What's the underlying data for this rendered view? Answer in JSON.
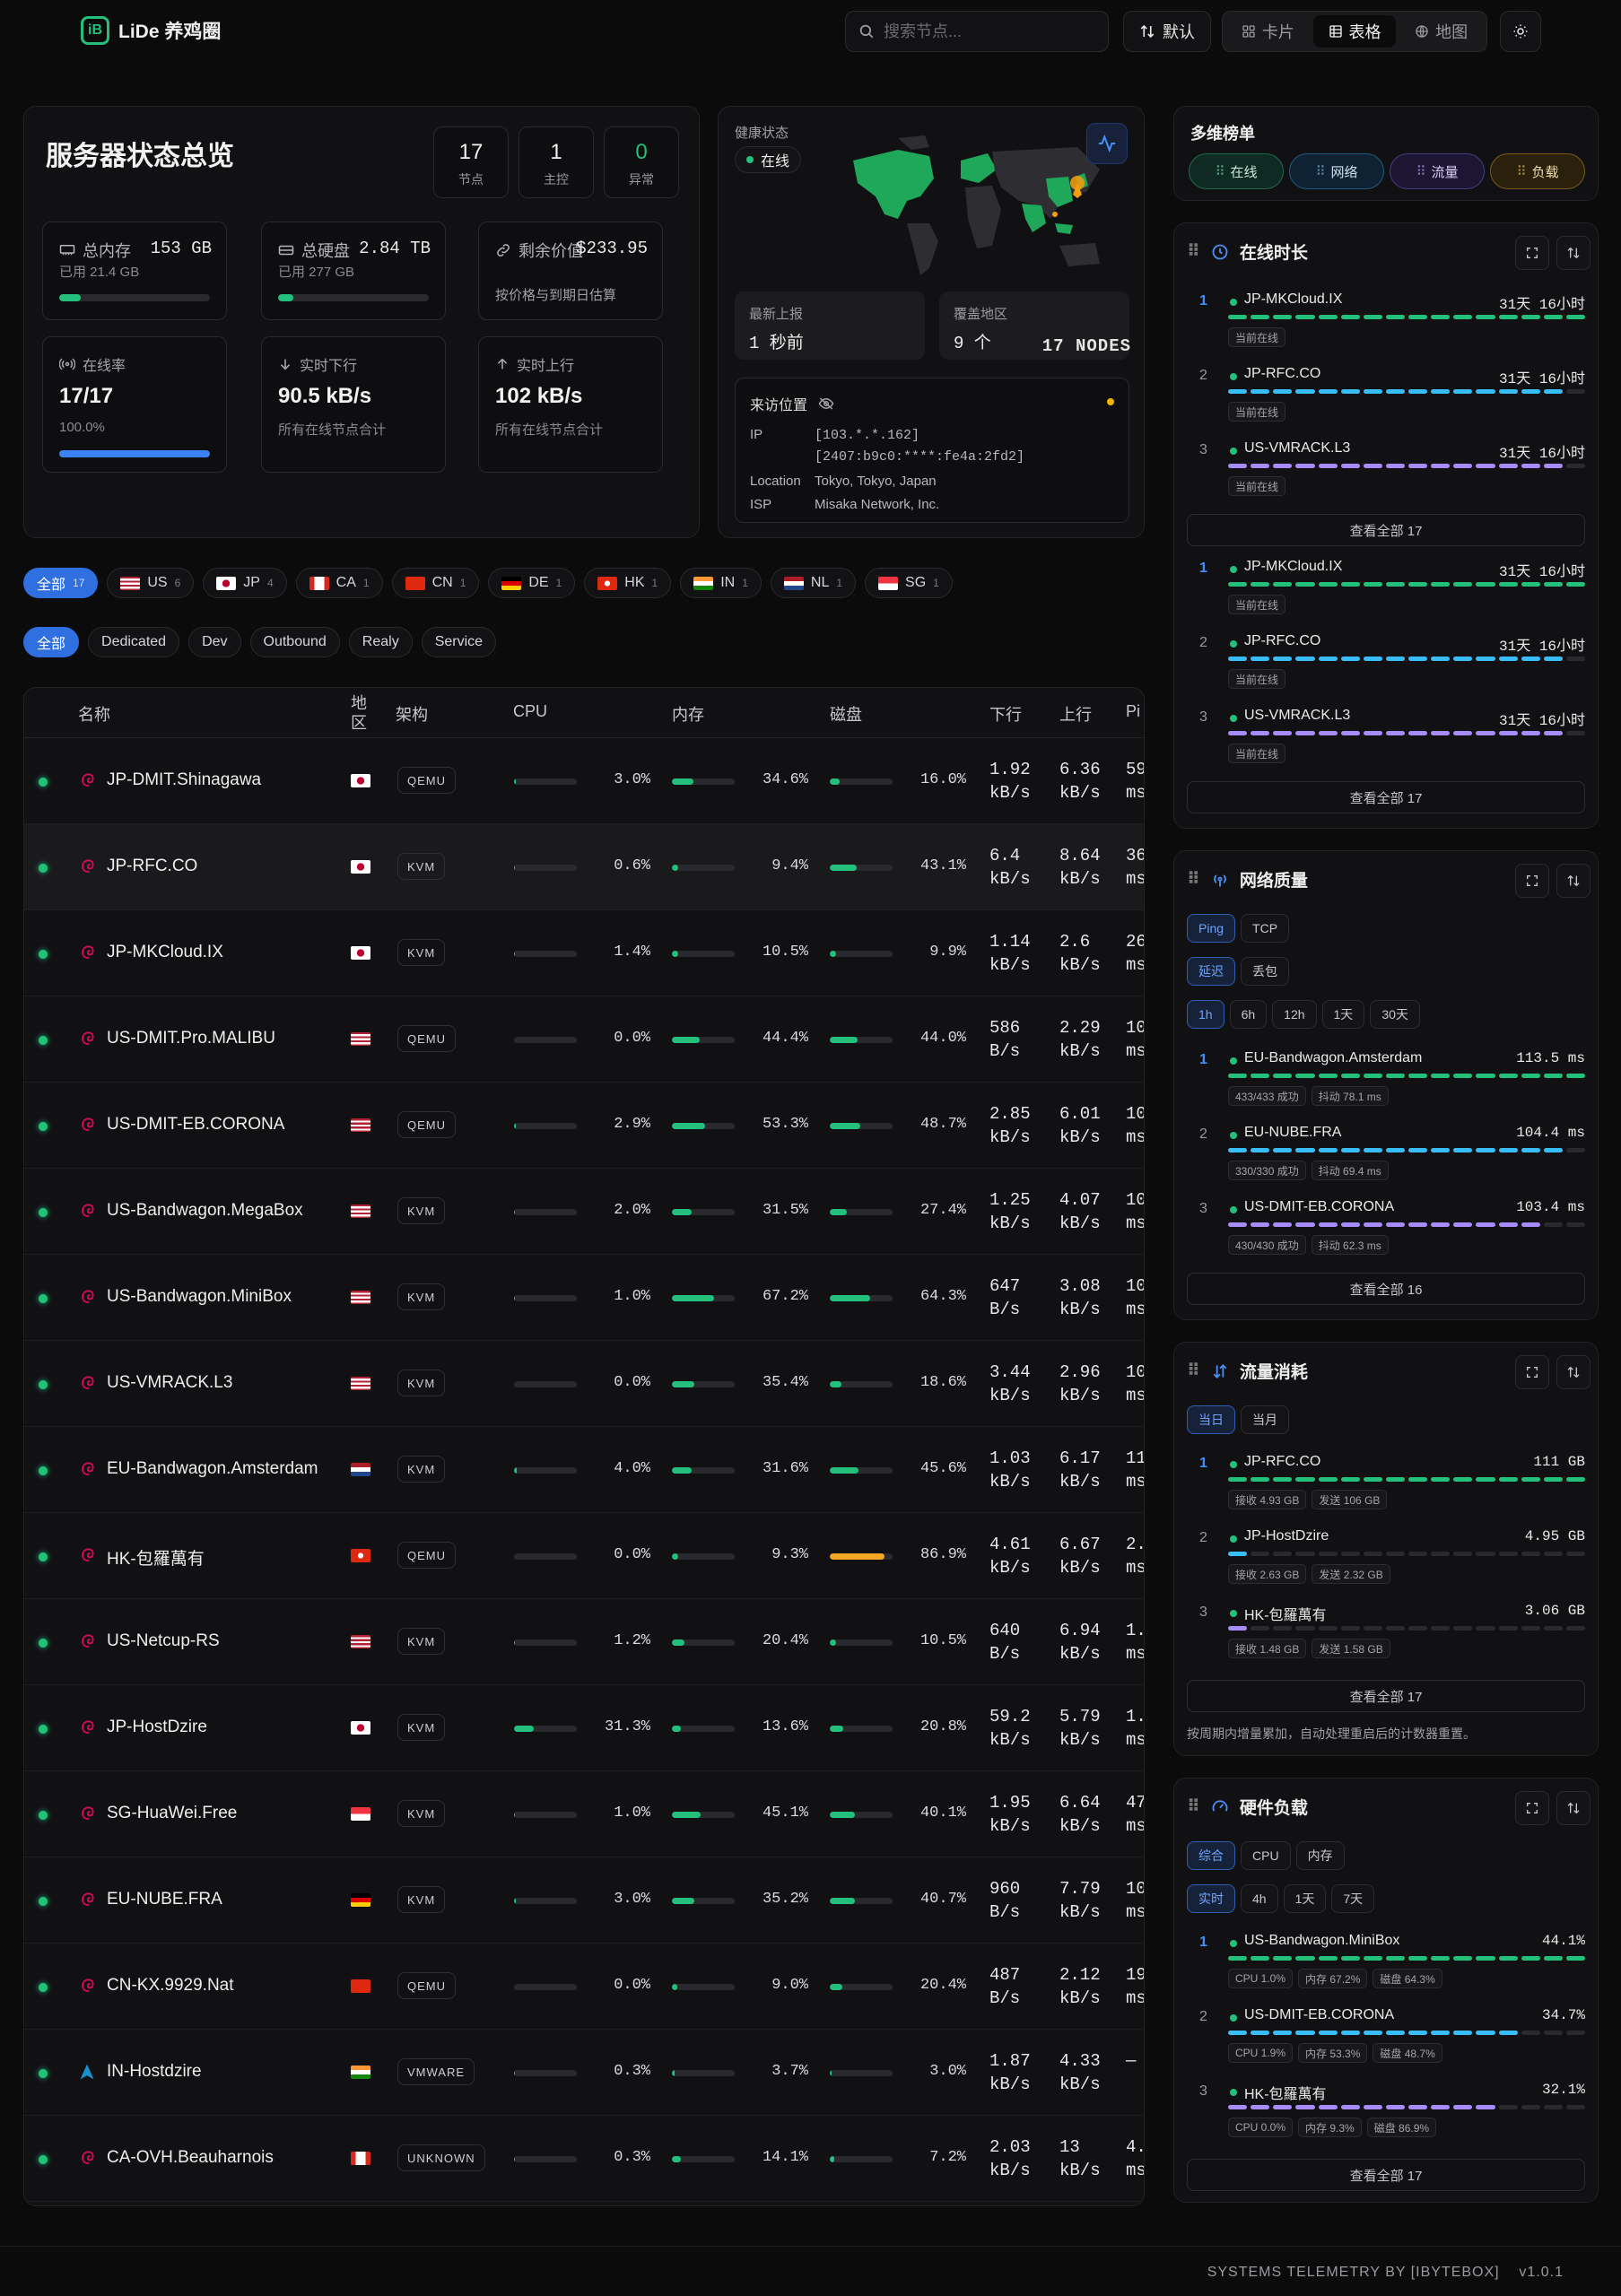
{
  "header": {
    "app_name": "LiDe 养鸡圈",
    "search_placeholder": "搜索节点...",
    "sort_label": "默认",
    "views": [
      "卡片",
      "表格",
      "地图"
    ],
    "active_view": "表格"
  },
  "overview": {
    "title": "服务器状态总览",
    "stats": [
      {
        "value": "17",
        "label": "节点"
      },
      {
        "value": "1",
        "label": "主控"
      },
      {
        "value": "0",
        "label": "异常"
      }
    ],
    "memory": {
      "label": "总内存",
      "value": "153 GB",
      "sub": "已用 21.4 GB",
      "fill": 0.14
    },
    "disk": {
      "label": "总硬盘",
      "value": "2.84 TB",
      "sub": "已用 277 GB",
      "fill": 0.1
    },
    "value": {
      "label": "剩余价值",
      "value": "$233.95",
      "sub": "按价格与到期日估算"
    },
    "online": {
      "label": "在线率",
      "value": "17/17",
      "sub": "100.0%",
      "fill": 1.0
    },
    "down": {
      "label": "实时下行",
      "value": "90.5 kB/s",
      "sub": "所有在线节点合计"
    },
    "up": {
      "label": "实时上行",
      "value": "102 kB/s",
      "sub": "所有在线节点合计"
    }
  },
  "health": {
    "label": "健康状态",
    "status": "在线",
    "latest_label": "最新上报",
    "latest_value": "1 秒前",
    "coverage_label": "覆盖地区",
    "coverage_value": "9 个",
    "nodes_count": "17 NODES",
    "visitor": {
      "title": "来访位置",
      "ip_label": "IP",
      "ipv4": "[103.*.*.162]",
      "ipv6": "[2407:b9c0:****:fe4a:2fd2]",
      "location_label": "Location",
      "location": "Tokyo, Tokyo, Japan",
      "isp_label": "ISP",
      "isp": "Misaka Network, Inc."
    }
  },
  "region_filters": [
    {
      "label": "全部",
      "count": "17",
      "flag": "",
      "active": true
    },
    {
      "label": "US",
      "count": "6",
      "flag": "us"
    },
    {
      "label": "JP",
      "count": "4",
      "flag": "jp"
    },
    {
      "label": "CA",
      "count": "1",
      "flag": "ca"
    },
    {
      "label": "CN",
      "count": "1",
      "flag": "cn"
    },
    {
      "label": "DE",
      "count": "1",
      "flag": "de"
    },
    {
      "label": "HK",
      "count": "1",
      "flag": "hk"
    },
    {
      "label": "IN",
      "count": "1",
      "flag": "in"
    },
    {
      "label": "NL",
      "count": "1",
      "flag": "nl"
    },
    {
      "label": "SG",
      "count": "1",
      "flag": "sg"
    }
  ],
  "tag_filters": [
    {
      "label": "全部",
      "active": true
    },
    {
      "label": "Dedicated"
    },
    {
      "label": "Dev"
    },
    {
      "label": "Outbound"
    },
    {
      "label": "Realy"
    },
    {
      "label": "Service"
    }
  ],
  "table": {
    "headers": {
      "name": "名称",
      "region": "地区",
      "arch": "架构",
      "cpu": "CPU",
      "mem": "内存",
      "disk": "磁盘",
      "down": "下行",
      "up": "上行",
      "ping": "Pi"
    },
    "rows": [
      {
        "name": "JP-DMIT.Shinagawa",
        "flag": "jp",
        "arch": "QEMU",
        "cpu": "3.0%",
        "cpu_v": 3.0,
        "mem": "34.6%",
        "mem_v": 34.6,
        "disk": "16.0%",
        "disk_v": 16.0,
        "down": [
          "1.92",
          "kB/s"
        ],
        "up": [
          "6.36",
          "kB/s"
        ],
        "ping": [
          "59",
          "ms"
        ],
        "os": "debian"
      },
      {
        "name": "JP-RFC.CO",
        "flag": "jp",
        "arch": "KVM",
        "cpu": "0.6%",
        "cpu_v": 0.6,
        "mem": "9.4%",
        "mem_v": 9.4,
        "disk": "43.1%",
        "disk_v": 43.1,
        "down": [
          "6.4",
          "kB/s"
        ],
        "up": [
          "8.64",
          "kB/s"
        ],
        "ping": [
          "36",
          "ms"
        ],
        "os": "debian"
      },
      {
        "name": "JP-MKCloud.IX",
        "flag": "jp",
        "arch": "KVM",
        "cpu": "1.4%",
        "cpu_v": 1.4,
        "mem": "10.5%",
        "mem_v": 10.5,
        "disk": "9.9%",
        "disk_v": 9.9,
        "down": [
          "1.14",
          "kB/s"
        ],
        "up": [
          "2.6",
          "kB/s"
        ],
        "ping": [
          "26",
          "ms"
        ],
        "os": "debian"
      },
      {
        "name": "US-DMIT.Pro.MALIBU",
        "flag": "us",
        "arch": "QEMU",
        "cpu": "0.0%",
        "cpu_v": 0.0,
        "mem": "44.4%",
        "mem_v": 44.4,
        "disk": "44.0%",
        "disk_v": 44.0,
        "down": [
          "586",
          "B/s"
        ],
        "up": [
          "2.29",
          "kB/s"
        ],
        "ping": [
          "10",
          "ms"
        ],
        "os": "debian"
      },
      {
        "name": "US-DMIT-EB.CORONA",
        "flag": "us",
        "arch": "QEMU",
        "cpu": "2.9%",
        "cpu_v": 2.9,
        "mem": "53.3%",
        "mem_v": 53.3,
        "disk": "48.7%",
        "disk_v": 48.7,
        "down": [
          "2.85",
          "kB/s"
        ],
        "up": [
          "6.01",
          "kB/s"
        ],
        "ping": [
          "10",
          "ms"
        ],
        "os": "debian"
      },
      {
        "name": "US-Bandwagon.MegaBox",
        "flag": "us",
        "arch": "KVM",
        "cpu": "2.0%",
        "cpu_v": 2.0,
        "mem": "31.5%",
        "mem_v": 31.5,
        "disk": "27.4%",
        "disk_v": 27.4,
        "down": [
          "1.25",
          "kB/s"
        ],
        "up": [
          "4.07",
          "kB/s"
        ],
        "ping": [
          "10",
          "ms"
        ],
        "os": "debian"
      },
      {
        "name": "US-Bandwagon.MiniBox",
        "flag": "us",
        "arch": "KVM",
        "cpu": "1.0%",
        "cpu_v": 1.0,
        "mem": "67.2%",
        "mem_v": 67.2,
        "disk": "64.3%",
        "disk_v": 64.3,
        "down": [
          "647",
          "B/s"
        ],
        "up": [
          "3.08",
          "kB/s"
        ],
        "ping": [
          "10",
          "ms"
        ],
        "os": "debian"
      },
      {
        "name": "US-VMRACK.L3",
        "flag": "us",
        "arch": "KVM",
        "cpu": "0.0%",
        "cpu_v": 0.0,
        "mem": "35.4%",
        "mem_v": 35.4,
        "disk": "18.6%",
        "disk_v": 18.6,
        "down": [
          "3.44",
          "kB/s"
        ],
        "up": [
          "2.96",
          "kB/s"
        ],
        "ping": [
          "10",
          "ms"
        ],
        "os": "debian"
      },
      {
        "name": "EU-Bandwagon.Amsterdam",
        "flag": "nl",
        "arch": "KVM",
        "cpu": "4.0%",
        "cpu_v": 4.0,
        "mem": "31.6%",
        "mem_v": 31.6,
        "disk": "45.6%",
        "disk_v": 45.6,
        "down": [
          "1.03",
          "kB/s"
        ],
        "up": [
          "6.17",
          "kB/s"
        ],
        "ping": [
          "11",
          "ms"
        ],
        "os": "debian"
      },
      {
        "name": "HK-包羅萬有",
        "flag": "hk",
        "arch": "QEMU",
        "cpu": "0.0%",
        "cpu_v": 0.0,
        "mem": "9.3%",
        "mem_v": 9.3,
        "disk": "86.9%",
        "disk_v": 86.9,
        "down": [
          "4.61",
          "kB/s"
        ],
        "up": [
          "6.67",
          "kB/s"
        ],
        "ping": [
          "2.",
          "ms"
        ],
        "os": "debian"
      },
      {
        "name": "US-Netcup-RS",
        "flag": "us",
        "arch": "KVM",
        "cpu": "1.2%",
        "cpu_v": 1.2,
        "mem": "20.4%",
        "mem_v": 20.4,
        "disk": "10.5%",
        "disk_v": 10.5,
        "down": [
          "640",
          "B/s"
        ],
        "up": [
          "6.94",
          "kB/s"
        ],
        "ping": [
          "1.",
          "ms"
        ],
        "os": "debian"
      },
      {
        "name": "JP-HostDzire",
        "flag": "jp",
        "arch": "KVM",
        "cpu": "31.3%",
        "cpu_v": 31.3,
        "mem": "13.6%",
        "mem_v": 13.6,
        "disk": "20.8%",
        "disk_v": 20.8,
        "down": [
          "59.2",
          "kB/s"
        ],
        "up": [
          "5.79",
          "kB/s"
        ],
        "ping": [
          "1.",
          "ms"
        ],
        "os": "debian"
      },
      {
        "name": "SG-HuaWei.Free",
        "flag": "sg",
        "arch": "KVM",
        "cpu": "1.0%",
        "cpu_v": 1.0,
        "mem": "45.1%",
        "mem_v": 45.1,
        "disk": "40.1%",
        "disk_v": 40.1,
        "down": [
          "1.95",
          "kB/s"
        ],
        "up": [
          "6.64",
          "kB/s"
        ],
        "ping": [
          "47",
          "ms"
        ],
        "os": "debian"
      },
      {
        "name": "EU-NUBE.FRA",
        "flag": "de",
        "arch": "KVM",
        "cpu": "3.0%",
        "cpu_v": 3.0,
        "mem": "35.2%",
        "mem_v": 35.2,
        "disk": "40.7%",
        "disk_v": 40.7,
        "down": [
          "960",
          "B/s"
        ],
        "up": [
          "7.79",
          "kB/s"
        ],
        "ping": [
          "10",
          "ms"
        ],
        "os": "debian"
      },
      {
        "name": "CN-KX.9929.Nat",
        "flag": "cn",
        "arch": "QEMU",
        "cpu": "0.0%",
        "cpu_v": 0.0,
        "mem": "9.0%",
        "mem_v": 9.0,
        "disk": "20.4%",
        "disk_v": 20.4,
        "down": [
          "487",
          "B/s"
        ],
        "up": [
          "2.12",
          "kB/s"
        ],
        "ping": [
          "19",
          "ms"
        ],
        "os": "debian"
      },
      {
        "name": "IN-Hostdzire",
        "flag": "in",
        "arch": "VMWARE",
        "cpu": "0.3%",
        "cpu_v": 0.3,
        "mem": "3.7%",
        "mem_v": 3.7,
        "disk": "3.0%",
        "disk_v": 3.0,
        "down": [
          "1.87",
          "kB/s"
        ],
        "up": [
          "4.33",
          "kB/s"
        ],
        "ping": [
          "—",
          ""
        ],
        "os": "arch"
      },
      {
        "name": "CA-OVH.Beauharnois",
        "flag": "ca",
        "arch": "UNKNOWN",
        "cpu": "0.3%",
        "cpu_v": 0.3,
        "mem": "14.1%",
        "mem_v": 14.1,
        "disk": "7.2%",
        "disk_v": 7.2,
        "down": [
          "2.03",
          "kB/s"
        ],
        "up": [
          "13",
          "kB/s"
        ],
        "ping": [
          "4.",
          "ms"
        ],
        "os": "debian"
      }
    ]
  },
  "rank_panel": {
    "title": "多维榜单",
    "tabs": [
      "在线",
      "网络",
      "流量",
      "负载"
    ]
  },
  "uptime": {
    "title": "在线时长",
    "items": [
      {
        "rank": "1",
        "name": "JP-MKCloud.IX",
        "value": "31天 16小时",
        "tag": "当前在线",
        "fill": 1.0,
        "color": "#22c07a"
      },
      {
        "rank": "2",
        "name": "JP-RFC.CO",
        "value": "31天 16小时",
        "tag": "当前在线",
        "fill": 0.93,
        "color": "#38bdf8"
      },
      {
        "rank": "3",
        "name": "US-VMRACK.L3",
        "value": "31天 16小时",
        "tag": "当前在线",
        "fill": 0.93,
        "color": "#a78bfa"
      }
    ],
    "view_all": "查看全部 17"
  },
  "uptime2": {
    "items": [
      {
        "rank": "1",
        "name": "JP-MKCloud.IX",
        "value": "31天 16小时",
        "tag": "当前在线",
        "fill": 1.0,
        "color": "#22c07a"
      },
      {
        "rank": "2",
        "name": "JP-RFC.CO",
        "value": "31天 16小时",
        "tag": "当前在线",
        "fill": 0.93,
        "color": "#38bdf8"
      },
      {
        "rank": "3",
        "name": "US-VMRACK.L3",
        "value": "31天 16小时",
        "tag": "当前在线",
        "fill": 0.93,
        "color": "#a78bfa"
      }
    ],
    "view_all": "查看全部 17"
  },
  "network": {
    "title": "网络质量",
    "proto": [
      "Ping",
      "TCP"
    ],
    "metric": [
      "延迟",
      "丢包"
    ],
    "range": [
      "1h",
      "6h",
      "12h",
      "1天",
      "30天"
    ],
    "items": [
      {
        "rank": "1",
        "name": "EU-Bandwagon.Amsterdam",
        "value": "113.5 ms",
        "tags": [
          "433/433 成功",
          "抖动 78.1 ms"
        ],
        "fill": 1.0,
        "color": "#22c07a"
      },
      {
        "rank": "2",
        "name": "EU-NUBE.FRA",
        "value": "104.4 ms",
        "tags": [
          "330/330 成功",
          "抖动 69.4 ms"
        ],
        "fill": 0.93,
        "color": "#38bdf8"
      },
      {
        "rank": "3",
        "name": "US-DMIT-EB.CORONA",
        "value": "103.4 ms",
        "tags": [
          "430/430 成功",
          "抖动 62.3 ms"
        ],
        "fill": 0.86,
        "color": "#a78bfa"
      }
    ],
    "view_all": "查看全部 16"
  },
  "traffic": {
    "title": "流量消耗",
    "range": [
      "当日",
      "当月"
    ],
    "items": [
      {
        "rank": "1",
        "name": "JP-RFC.CO",
        "value": "111 GB",
        "tags": [
          "接收 4.93 GB",
          "发送 106 GB"
        ],
        "fill": 1.0,
        "color": "#22c07a"
      },
      {
        "rank": "2",
        "name": "JP-HostDzire",
        "value": "4.95 GB",
        "tags": [
          "接收 2.63 GB",
          "发送 2.32 GB"
        ],
        "fill": 0.07,
        "color": "#38bdf8"
      },
      {
        "rank": "3",
        "name": "HK-包羅萬有",
        "value": "3.06 GB",
        "tags": [
          "接收 1.48 GB",
          "发送 1.58 GB"
        ],
        "fill": 0.07,
        "color": "#a78bfa"
      }
    ],
    "view_all": "查看全部 17",
    "note": "按周期内增量累加，自动处理重启后的计数器重置。"
  },
  "load": {
    "title": "硬件负载",
    "metric": [
      "综合",
      "CPU",
      "内存"
    ],
    "range": [
      "实时",
      "4h",
      "1天",
      "7天"
    ],
    "items": [
      {
        "rank": "1",
        "name": "US-Bandwagon.MiniBox",
        "value": "44.1%",
        "tags": [
          "CPU 1.0%",
          "内存 67.2%",
          "磁盘 64.3%"
        ],
        "fill": 1.0,
        "color": "#22c07a"
      },
      {
        "rank": "2",
        "name": "US-DMIT-EB.CORONA",
        "value": "34.7%",
        "tags": [
          "CPU 1.9%",
          "内存 53.3%",
          "磁盘 48.7%"
        ],
        "fill": 0.79,
        "color": "#38bdf8"
      },
      {
        "rank": "3",
        "name": "HK-包羅萬有",
        "value": "32.1%",
        "tags": [
          "CPU 0.0%",
          "内存 9.3%",
          "磁盘 86.9%"
        ],
        "fill": 0.72,
        "color": "#a78bfa"
      }
    ],
    "view_all": "查看全部 17"
  },
  "footer": {
    "text": "SYSTEMS TELEMETRY BY [IBYTEBOX]",
    "version": "v1.0.1"
  }
}
